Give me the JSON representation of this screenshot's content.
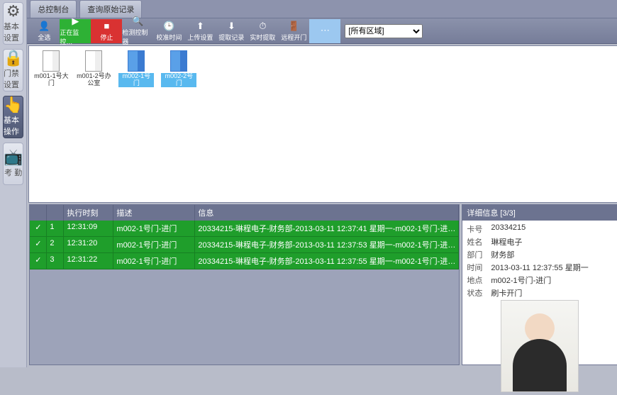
{
  "sidebar": [
    {
      "icon": "⚙",
      "label": "基本设置"
    },
    {
      "icon": "🔒",
      "label": "门禁设置"
    },
    {
      "icon": "👆",
      "label": "基本操作"
    },
    {
      "icon": "📺",
      "label": "考 勤"
    }
  ],
  "sidebar_active": 2,
  "tabs": [
    "总控制台",
    "查询原始记录"
  ],
  "toolbar": [
    {
      "icon": "👤",
      "label": "全选",
      "cls": ""
    },
    {
      "icon": "▶",
      "label": "正在监控…",
      "cls": "green"
    },
    {
      "icon": "■",
      "label": "停止",
      "cls": "red"
    },
    {
      "icon": "🔍",
      "label": "检测控制器",
      "cls": ""
    },
    {
      "icon": "🕒",
      "label": "校准时间",
      "cls": ""
    },
    {
      "icon": "⬆",
      "label": "上传设置",
      "cls": ""
    },
    {
      "icon": "⬇",
      "label": "提取记录",
      "cls": ""
    },
    {
      "icon": "⏱",
      "label": "实时提取",
      "cls": ""
    },
    {
      "icon": "🚪",
      "label": "远程开门",
      "cls": ""
    },
    {
      "icon": "⋯",
      "label": "",
      "cls": "highlight"
    }
  ],
  "area_select": "[所有区域]",
  "doors": [
    {
      "label": "m001-1号大门",
      "blue": false,
      "hl": false
    },
    {
      "label": "m001-2号办公室",
      "blue": false,
      "hl": false
    },
    {
      "label": "m002-1号门",
      "blue": true,
      "hl": true
    },
    {
      "label": "m002-2号门",
      "blue": true,
      "hl": true
    }
  ],
  "log_headers": [
    "",
    "",
    "执行时刻",
    "描述",
    "信息"
  ],
  "log_rows": [
    {
      "chk": "✓",
      "idx": "1",
      "time": "12:31:09",
      "desc": "m002-1号门-进门",
      "info": "20334215-琳程电子-财务部-2013-03-11 12:37:41 星期一-m002-1号门-进…"
    },
    {
      "chk": "✓",
      "idx": "2",
      "time": "12:31:20",
      "desc": "m002-1号门-进门",
      "info": "20334215-琳程电子-财务部-2013-03-11 12:37:53 星期一-m002-1号门-进…"
    },
    {
      "chk": "✓",
      "idx": "3",
      "time": "12:31:22",
      "desc": "m002-1号门-进门",
      "info": "20334215-琳程电子-财务部-2013-03-11 12:37:55 星期一-m002-1号门-进…"
    }
  ],
  "detail_title": "详细信息   [3/3]",
  "detail": [
    {
      "k": "卡号",
      "v": "20334215"
    },
    {
      "k": "姓名",
      "v": "琳程电子"
    },
    {
      "k": "部门",
      "v": "财务部"
    },
    {
      "k": "时间",
      "v": "2013-03-11 12:37:55 星期一"
    },
    {
      "k": "地点",
      "v": "m002-1号门-进门"
    },
    {
      "k": "状态",
      "v": "刷卡开门"
    }
  ]
}
